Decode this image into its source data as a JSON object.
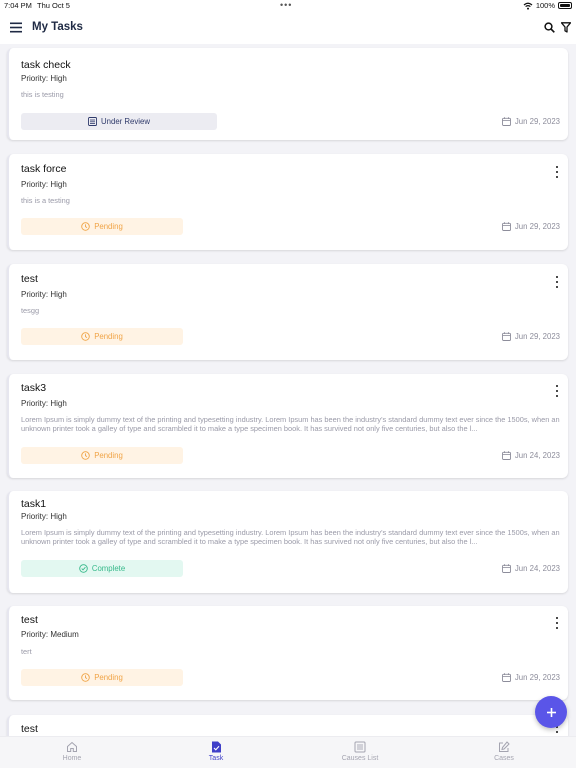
{
  "status": {
    "time": "7:04 PM",
    "date": "Thu Oct 5",
    "battery": "100%"
  },
  "header": {
    "title": "My Tasks"
  },
  "tasks": [
    {
      "title": "task check",
      "priority": "Priority: High",
      "description": "this is testing",
      "status": "Under Review",
      "date": "Jun 29, 2023",
      "has_menu": false
    },
    {
      "title": "task force",
      "priority": "Priority: High",
      "description": "this is a testing",
      "status": "Pending",
      "date": "Jun 29, 2023",
      "has_menu": true
    },
    {
      "title": "test",
      "priority": "Priority: High",
      "description": "tesgg",
      "status": "Pending",
      "date": "Jun 29, 2023",
      "has_menu": true
    },
    {
      "title": "task3",
      "priority": "Priority: High",
      "description": "Lorem Ipsum is simply dummy text of the printing and typesetting industry. Lorem Ipsum has been the industry's standard dummy text ever since the 1500s, when an unknown printer took a galley of type and scrambled it to make a type specimen book. It has survived not only five centuries, but also the l...",
      "status": "Pending",
      "date": "Jun 24, 2023",
      "has_menu": true
    },
    {
      "title": "task1",
      "priority": "Priority: High",
      "description": "Lorem Ipsum is simply dummy text of the printing and typesetting industry. Lorem Ipsum has been the industry's standard dummy text ever since the 1500s, when an unknown printer took a galley of type and scrambled it to make a type specimen book. It has survived not only five centuries, but also the l...",
      "status": "Complete",
      "date": "Jun 24, 2023",
      "has_menu": false
    },
    {
      "title": "test",
      "priority": "Priority: Medium",
      "description": "tert",
      "status": "Pending",
      "date": "Jun 29, 2023",
      "has_menu": true
    },
    {
      "title": "test",
      "priority": "",
      "description": "",
      "status": "",
      "date": "",
      "has_menu": true
    }
  ],
  "tabs": [
    {
      "label": "Home",
      "icon": "home-icon",
      "active": false
    },
    {
      "label": "Task",
      "icon": "task-icon",
      "active": true
    },
    {
      "label": "Causes List",
      "icon": "list-icon",
      "active": false
    },
    {
      "label": "Cases",
      "icon": "edit-icon",
      "active": false
    }
  ],
  "colors": {
    "accent": "#5a55e8",
    "active_tab": "#3f3fc8",
    "pending": "#f0a447",
    "pending_bg": "#fff3e4",
    "complete": "#36b98a",
    "complete_bg": "#e3f8f1",
    "review": "#2f3a6b",
    "review_bg": "#ececf2"
  }
}
